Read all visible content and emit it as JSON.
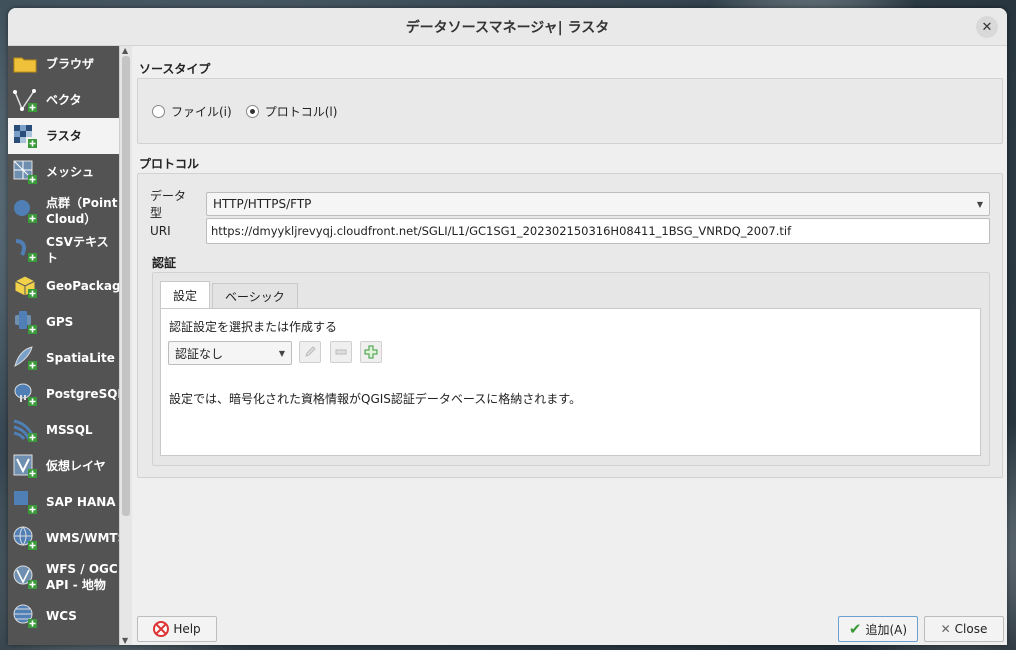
{
  "window": {
    "title": "データソースマネージャ| ラスタ"
  },
  "sidebar": {
    "items": [
      {
        "label": "ブラウザ",
        "icon": "folder-icon"
      },
      {
        "label": "ベクタ",
        "icon": "vector-icon"
      },
      {
        "label": "ラスタ",
        "icon": "raster-icon",
        "active": true
      },
      {
        "label": "メッシュ",
        "icon": "mesh-icon"
      },
      {
        "label": "点群（Point Cloud）",
        "line1": "点群（Point",
        "line2": "Cloud）",
        "icon": "point-cloud-icon"
      },
      {
        "label": "CSVテキスト",
        "icon": "csv-icon"
      },
      {
        "label": "GeoPackage",
        "icon": "geopackage-icon"
      },
      {
        "label": "GPS",
        "icon": "gps-icon"
      },
      {
        "label": "SpatiaLite",
        "icon": "spatialite-icon"
      },
      {
        "label": "PostgreSQL",
        "icon": "postgresql-icon"
      },
      {
        "label": "MSSQL",
        "icon": "mssql-icon"
      },
      {
        "label": "仮想レイヤ",
        "icon": "virtual-layer-icon"
      },
      {
        "label": "SAP HANA",
        "icon": "sap-hana-icon"
      },
      {
        "label": "WMS/WMTS",
        "icon": "wms-icon"
      },
      {
        "label": "WFS / OGC API - 地物",
        "line1": "WFS / OGC",
        "line2": "API - 地物",
        "icon": "wfs-icon"
      },
      {
        "label": "WCS",
        "icon": "wcs-icon"
      }
    ]
  },
  "source_type": {
    "title": "ソースタイプ",
    "file_label": "ファイル(i)",
    "protocol_label": "プロトコル(l)",
    "selected": "protocol"
  },
  "protocol": {
    "title": "プロトコル",
    "type_label": "データ型",
    "type_value": "HTTP/HTTPS/FTP",
    "uri_label": "URI",
    "uri_value": "https://dmyykljrevyqj.cloudfront.net/SGLI/L1/GC1SG1_202302150316H08411_1BSG_VNRDQ_2007.tif"
  },
  "auth": {
    "title": "認証",
    "tabs": [
      "設定",
      "ベーシック"
    ],
    "active_tab": 0,
    "select_prompt": "認証設定を選択または作成する",
    "select_value": "認証なし",
    "info": "設定では、暗号化された資格情報がQGIS認証データベースに格納されます。"
  },
  "footer": {
    "help_label": "Help",
    "add_label": "追加(A)",
    "close_label": "Close"
  },
  "colors": {
    "sidebar_bg": "#535353",
    "active_bg": "#f3f3f3",
    "accent_green": "#3a9a3a"
  }
}
